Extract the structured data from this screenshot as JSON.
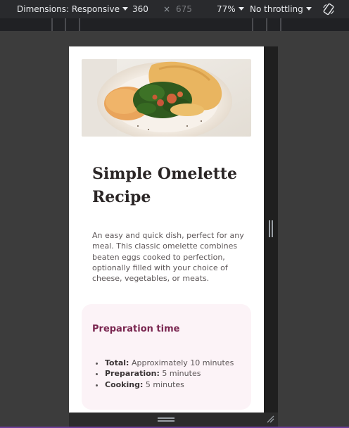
{
  "toolbar": {
    "dimensions_label": "Dimensions: Responsive",
    "width": "360",
    "times": "×",
    "height": "675",
    "zoom": "77%",
    "throttling": "No throttling"
  },
  "page": {
    "title": "Simple Omelette Recipe",
    "description": "An easy and quick dish, perfect for any meal. This classic omelette combines beaten eggs cooked to perfection, optionally filled with your choice of cheese, vegetables, or meats.",
    "prep": {
      "heading": "Preparation time",
      "items": [
        {
          "label": "Total:",
          "value": " Approximately 10 minutes"
        },
        {
          "label": "Preparation:",
          "value": " 5 minutes"
        },
        {
          "label": "Cooking:",
          "value": " 5 minutes"
        }
      ]
    }
  },
  "colors": {
    "heading": "#2b2626",
    "prep_heading": "#7a2650",
    "prep_background": "#fcf3f7",
    "devtools_bg": "#3c3c3c"
  }
}
